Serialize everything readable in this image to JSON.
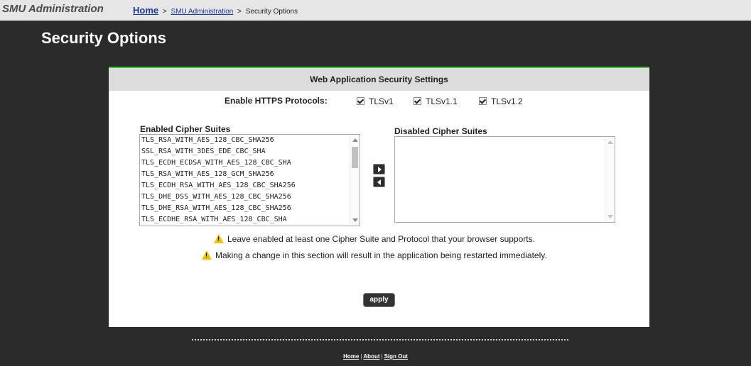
{
  "header": {
    "app_title": "SMU Administration",
    "breadcrumb": {
      "home": "Home",
      "sep1": ">",
      "section": "SMU Administration",
      "sep2": ">",
      "current": "Security Options"
    }
  },
  "page": {
    "title": "Security Options"
  },
  "panel": {
    "title": "Web Application Security Settings",
    "https": {
      "label": "Enable HTTPS Protocols:",
      "protocols": [
        {
          "label": "TLSv1",
          "checked": true
        },
        {
          "label": "TLSv1.1",
          "checked": true
        },
        {
          "label": "TLSv1.2",
          "checked": true
        }
      ]
    },
    "enabled": {
      "label": "Enabled Cipher Suites",
      "items": [
        "TLS_RSA_WITH_AES_128_CBC_SHA256",
        "SSL_RSA_WITH_3DES_EDE_CBC_SHA",
        "TLS_ECDH_ECDSA_WITH_AES_128_CBC_SHA",
        "TLS_RSA_WITH_AES_128_GCM_SHA256",
        "TLS_ECDH_RSA_WITH_AES_128_CBC_SHA256",
        "TLS_DHE_DSS_WITH_AES_128_CBC_SHA256",
        "TLS_DHE_RSA_WITH_AES_128_CBC_SHA256",
        "TLS_ECDHE_RSA_WITH_AES_128_CBC_SHA"
      ]
    },
    "disabled": {
      "label": "Disabled Cipher Suites",
      "items": []
    },
    "warnings": [
      "Leave enabled at least one Cipher Suite and Protocol that your browser supports.",
      "Making a change in this section will result in the application being restarted immediately."
    ],
    "apply_label": "apply"
  },
  "footer": {
    "links": [
      "Home",
      "About",
      "Sign Out"
    ],
    "separator": "|"
  },
  "colors": {
    "accent_green": "#43c343",
    "page_background": "#2b2b2b",
    "header_background": "#e6e6e6",
    "link_blue": "#1a3aa0",
    "warning_yellow": "#f2c200"
  },
  "icons": [
    "warning-icon",
    "arrow-right-icon",
    "arrow-left-icon",
    "checkbox-checked-icon"
  ]
}
